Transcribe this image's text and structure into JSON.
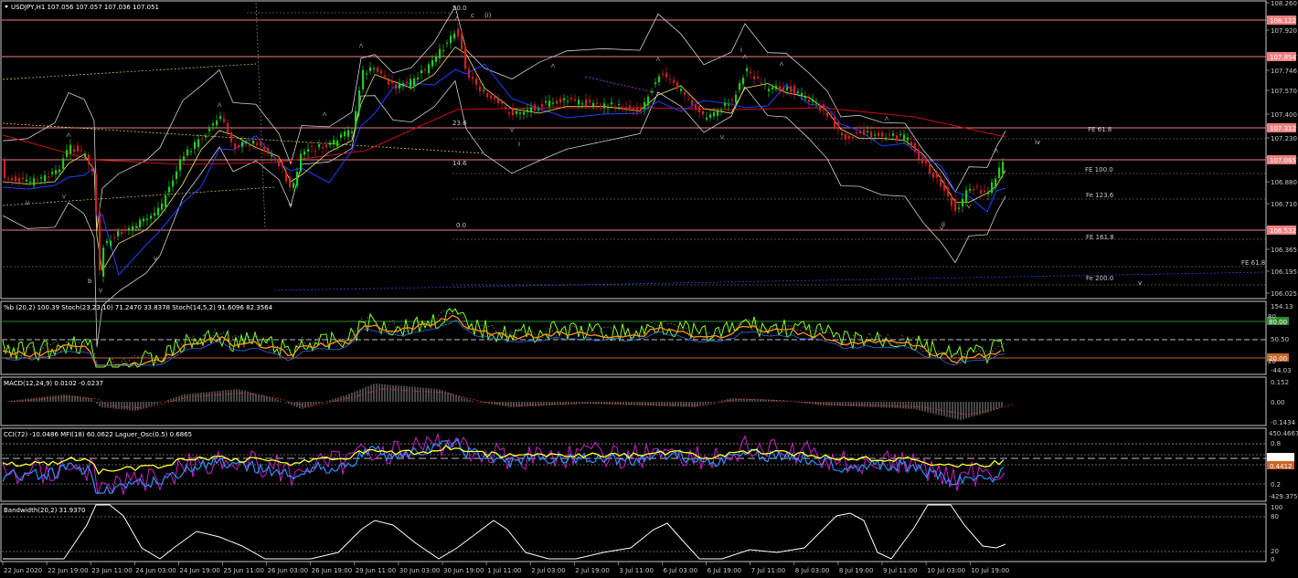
{
  "panes": {
    "main": {
      "caption": "USDJPY,H1  107.056 107.057 107.036 107.051",
      "axis_labels": [
        "108.260",
        "108.122",
        "107.920",
        "107.854",
        "107.746",
        "107.570",
        "107.400",
        "107.312",
        "107.230",
        "107.065",
        "106.880",
        "106.710",
        "106.532",
        "106.365",
        "106.195",
        "106.025"
      ],
      "price_markers": [
        {
          "value": "108.122",
          "color": "#f08080"
        },
        {
          "value": "107.854",
          "color": "#f08080"
        },
        {
          "value": "107.312",
          "color": "#f08080"
        },
        {
          "value": "107.065",
          "color": "#f08080"
        },
        {
          "value": "106.532",
          "color": "#f08080"
        }
      ],
      "fib_labels": [
        "50.0",
        "23.6",
        "14.6",
        "0.0"
      ],
      "fe_labels": [
        "FE 61.8",
        "FE 100.0",
        "Fe 123.6",
        "FE 161.8",
        "FE 61.8",
        "Fe 200.0"
      ],
      "wave_labels": [
        "c",
        "(i)",
        "i",
        "i",
        "ii",
        "iv",
        "b",
        "v"
      ]
    },
    "stoch": {
      "caption": "%b (20,2) 100.39  Stoch(23,23,10) 71.2470 33.8378  Stoch(14,5,2) 91.6096 82.3564",
      "axis_labels": [
        "154.13",
        "50.50",
        "-44.03"
      ],
      "markers": [
        {
          "value": "80.00",
          "color": "#2e8b2e"
        },
        {
          "value": "20.00",
          "color": "#c86428"
        }
      ],
      "level_labels": [
        "80",
        "20"
      ]
    },
    "macd": {
      "caption": "MACD(12,24,9) 0.0102 -0.0237",
      "axis_labels": [
        "0.152",
        "0.00",
        "-0.1434"
      ]
    },
    "cci": {
      "caption": "CCI(72) -10.0486  MFI(18) 60.0622  Laguer_Osc(0.5) 0.6865",
      "axis_labels": [
        "450.4667",
        "0.8",
        "0.5",
        "0.2",
        "-429.3751"
      ],
      "markers": [
        {
          "value": "0.5623",
          "color": "#ffffff"
        },
        {
          "value": "0.4412",
          "color": "#c86428"
        }
      ]
    },
    "bw": {
      "caption": "Bandwidth(20,2) 31.9370",
      "axis_labels": [
        "100",
        "80",
        "20",
        "0"
      ]
    }
  },
  "time_axis": [
    "22 Jun 2020",
    "22 Jun 19:00",
    "23 Jun 11:00",
    "24 Jun 03:00",
    "24 Jun 19:00",
    "25 Jun 11:00",
    "26 Jun 03:00",
    "26 Jun 19:00",
    "29 Jun 11:00",
    "30 Jun 03:00",
    "30 Jun 19:00",
    "1 Jul 11:00",
    "2 Jul 03:00",
    "2 Jul 19:00",
    "3 Jul 11:00",
    "6 Jul 03:00",
    "6 Jul 19:00",
    "7 Jul 11:00",
    "8 Jul 03:00",
    "8 Jul 19:00",
    "9 Jul 11:00",
    "10 Jul 03:00",
    "10 Jul 19:00"
  ],
  "colors": {
    "background": "#000000",
    "frame": "#c8c8c8",
    "bull": "#22cc22",
    "bear": "#cc2222",
    "resistance": "#f08080",
    "band": "#d0d0d0",
    "ma_blue": "#2040ff",
    "ma_yellow": "#e8e870",
    "ma_red": "#cc1111",
    "stoch_green": "#80ff20",
    "stoch_orange": "#ff9020",
    "cci_magenta": "#cc22cc",
    "cci_blue": "#3090ff",
    "cci_yellow": "#ffff30"
  }
}
